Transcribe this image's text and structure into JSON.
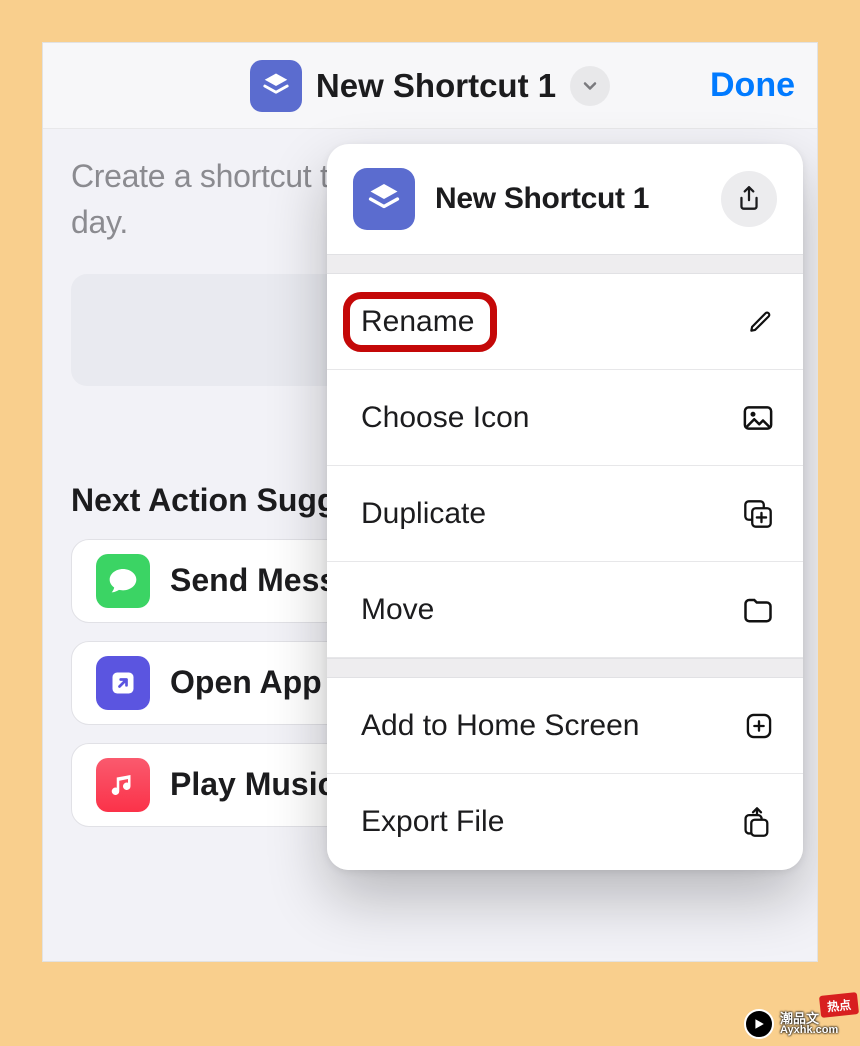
{
  "navbar": {
    "title": "New Shortcut 1",
    "done_label": "Done"
  },
  "body": {
    "intro": "Create a shortcut to do more with your apps every day.",
    "section_title": "Next Action Suggestions",
    "actions": {
      "messages": "Send Message",
      "openapp": "Open App",
      "music": "Play Music"
    }
  },
  "popover": {
    "title": "New Shortcut 1",
    "rows": {
      "rename": "Rename",
      "choose_icon": "Choose Icon",
      "duplicate": "Duplicate",
      "move": "Move",
      "add_home": "Add to Home Screen",
      "export": "Export File"
    }
  },
  "watermark": {
    "cn": "潮品文",
    "domain": "Ayxhk.com",
    "badge": "热点"
  }
}
